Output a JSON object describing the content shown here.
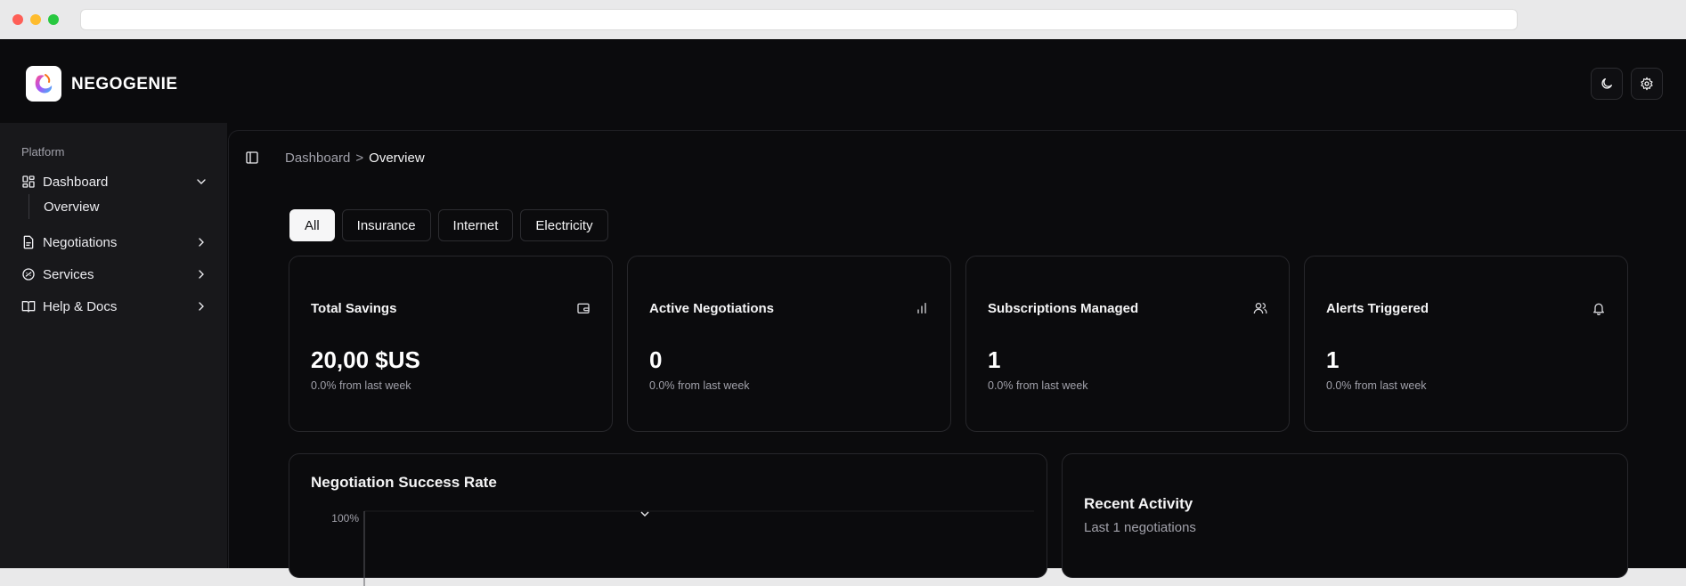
{
  "app": {
    "brand": "NEGOGENIE"
  },
  "sidebar": {
    "section": "Platform",
    "items": [
      {
        "label": "Dashboard",
        "icon": "dashboard-icon"
      },
      {
        "label": "Negotiations",
        "icon": "document-icon"
      },
      {
        "label": "Services",
        "icon": "gauge-icon"
      },
      {
        "label": "Help & Docs",
        "icon": "book-icon"
      }
    ],
    "sub_items": [
      {
        "label": "Overview"
      }
    ]
  },
  "breadcrumb": {
    "parent": "Dashboard",
    "separator": ">",
    "current": "Overview"
  },
  "tabs": [
    {
      "label": "All",
      "active": true
    },
    {
      "label": "Insurance",
      "active": false
    },
    {
      "label": "Internet",
      "active": false
    },
    {
      "label": "Electricity",
      "active": false
    }
  ],
  "stats": [
    {
      "title": "Total Savings",
      "value": "20,00 $US",
      "delta": "0.0% from last week",
      "icon": "wallet-icon"
    },
    {
      "title": "Active Negotiations",
      "value": "0",
      "delta": "0.0% from last week",
      "icon": "bar-chart-icon"
    },
    {
      "title": "Subscriptions Managed",
      "value": "1",
      "delta": "0.0% from last week",
      "icon": "users-icon"
    },
    {
      "title": "Alerts Triggered",
      "value": "1",
      "delta": "0.0% from last week",
      "icon": "bell-icon"
    }
  ],
  "success_rate": {
    "title": "Negotiation Success Rate",
    "y_tick_top": "100%"
  },
  "recent_activity": {
    "title": "Recent Activity",
    "subtitle": "Last 1 negotiations"
  },
  "chart_data": {
    "type": "line",
    "title": "Negotiation Success Rate",
    "y_ticks": [
      "100%"
    ],
    "ylim": [
      0,
      100
    ]
  },
  "colors": {
    "background": "#0b0b0d",
    "sidebar": "#18181b",
    "border": "#27272b",
    "text": "#f4f4f5",
    "muted": "#a1a1aa"
  }
}
